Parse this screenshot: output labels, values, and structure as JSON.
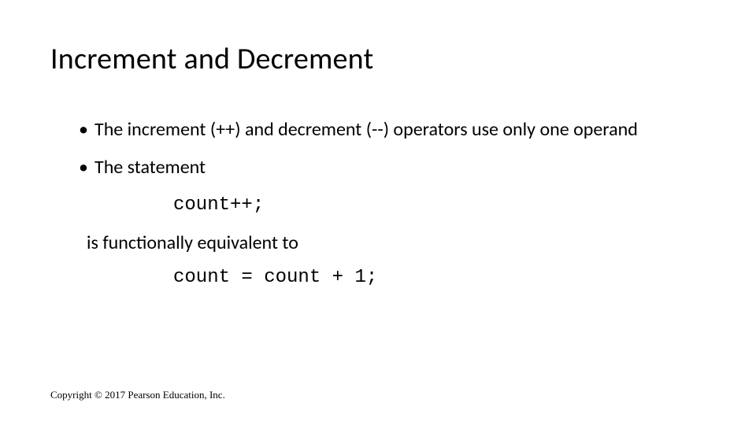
{
  "title": "Increment and Decrement",
  "bullets": {
    "b1": "The increment (++) and decrement (--) operators use only one operand",
    "b2": "The statement"
  },
  "code": {
    "inc": "count++;",
    "eq": "count = count + 1;"
  },
  "plain": {
    "equiv": "is functionally equivalent to"
  },
  "footer": "Copyright © 2017 Pearson Education, Inc."
}
